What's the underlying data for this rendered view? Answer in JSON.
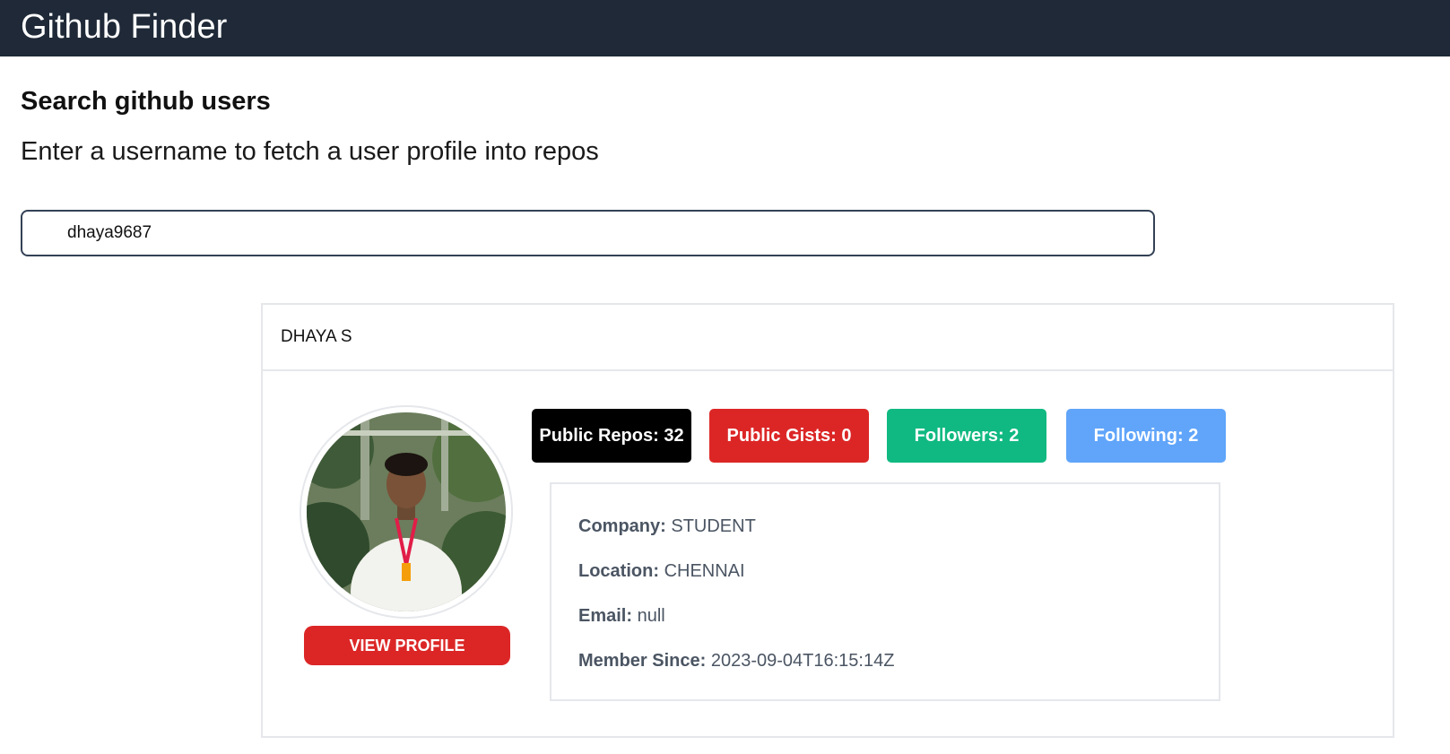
{
  "app": {
    "title": "Github Finder"
  },
  "search": {
    "heading": "Search github users",
    "subheading": "Enter a username to fetch a user profile into repos",
    "value": "dhaya9687"
  },
  "profile": {
    "name": "DHAYA S",
    "view_profile_label": "VIEW PROFILE",
    "stats": {
      "public_repos": "Public Repos: 32",
      "public_gists": "Public Gists: 0",
      "followers": "Followers: 2",
      "following": "Following: 2"
    },
    "details": {
      "company_label": "Company:",
      "company_value": "STUDENT",
      "location_label": "Location:",
      "location_value": "CHENNAI",
      "email_label": "Email:",
      "email_value": "null",
      "member_since_label": "Member Since:",
      "member_since_value": "2023-09-04T16:15:14Z"
    }
  },
  "colors": {
    "navbar": "#1f2937",
    "repos": "#000000",
    "gists": "#dc2626",
    "followers": "#10b981",
    "following": "#60a5fa",
    "view_button": "#dc2626"
  }
}
